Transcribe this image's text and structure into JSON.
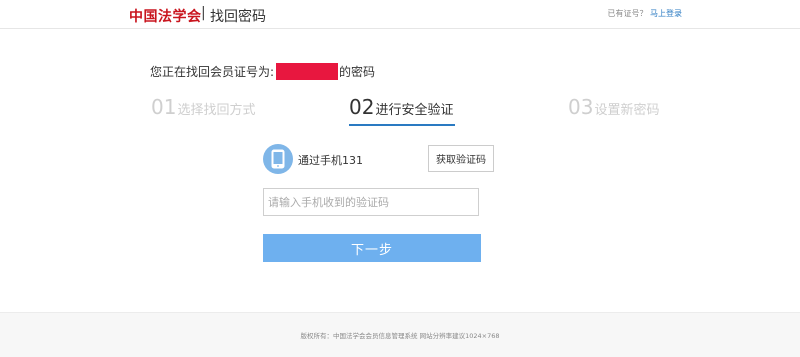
{
  "header": {
    "logo": "中国法学会",
    "separator": "|",
    "title": "找回密码",
    "prompt": "已有证号？",
    "login_link": "马上登录"
  },
  "main": {
    "account_prefix": "您正在找回会员证号为:",
    "account_suffix": "的密码",
    "steps": [
      {
        "num": "01",
        "label": "选择找回方式"
      },
      {
        "num": "02",
        "label": "进行安全验证"
      },
      {
        "num": "03",
        "label": "设置新密码"
      }
    ],
    "verify_method": "通过手机131",
    "get_code_label": "获取验证码",
    "code_placeholder": "请输入手机收到的验证码",
    "code_value": "",
    "next_label": "下一步"
  },
  "footer": {
    "text": "版权所有：中国法学会会员信息管理系统 网站分辨率建议1024×768"
  },
  "colors": {
    "brand": "#c9151e",
    "accent": "#2a7ac2",
    "button": "#6eb0ef",
    "masked": "#e8173f"
  }
}
